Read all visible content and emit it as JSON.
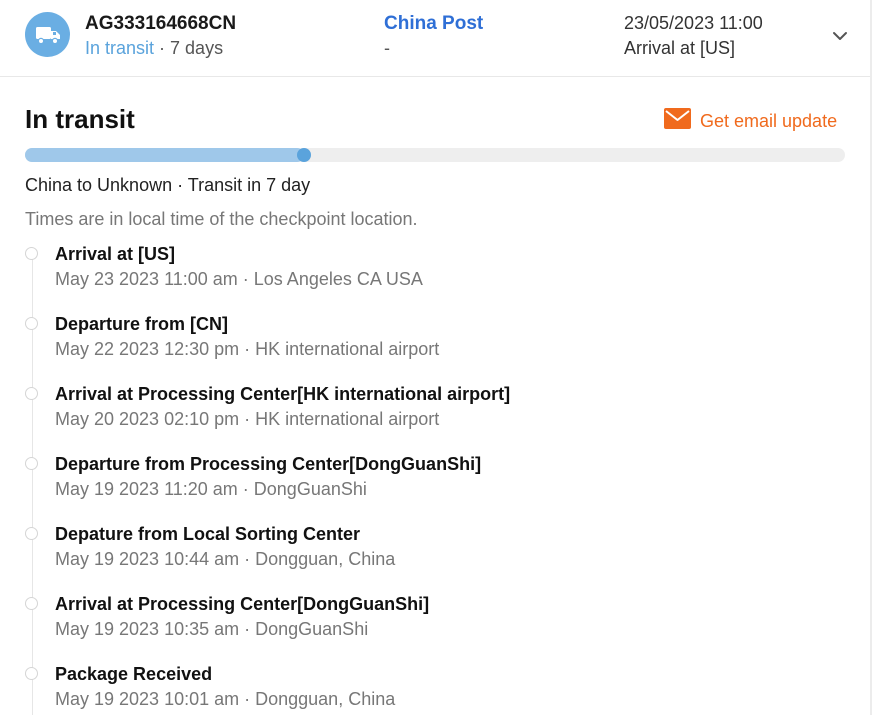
{
  "shipment": {
    "tracking_number": "AG333164668CN",
    "status": "In transit",
    "separator": " · ",
    "duration": "7 days",
    "carrier": "China Post",
    "carrier_sub": "-",
    "latest_time": "23/05/2023 11:00",
    "latest_event": "Arrival at [US]",
    "icon": "truck-icon",
    "expand_icon": "chevron-down-icon"
  },
  "detail": {
    "title": "In transit",
    "email_update_label": "Get email update",
    "email_icon": "envelope-icon",
    "progress_fraction": 0.34,
    "route": "China to Unknown · Transit in 7 day",
    "timezone_note": "Times are in local time of the checkpoint location."
  },
  "checkpoints": [
    {
      "event": "Arrival at [US]",
      "meta": "May 23 2023 11:00 am · Los Angeles CA USA"
    },
    {
      "event": "Departure from [CN]",
      "meta": "May 22 2023 12:30 pm · HK international airport"
    },
    {
      "event": "Arrival at Processing Center[HK international airport]",
      "meta": "May 20 2023 02:10 pm · HK international airport"
    },
    {
      "event": "Departure from Processing Center[DongGuanShi]",
      "meta": "May 19 2023 11:20 am · DongGuanShi"
    },
    {
      "event": "Depature from Local Sorting Center",
      "meta": "May 19 2023 10:44 am · Dongguan, China"
    },
    {
      "event": "Arrival at Processing Center[DongGuanShi]",
      "meta": "May 19 2023 10:35 am · DongGuanShi"
    },
    {
      "event": "Package Received",
      "meta": "May 19 2023 10:01 am · Dongguan, China"
    }
  ],
  "colors": {
    "accent_blue": "#5aa3dc",
    "carrier_blue": "#2f6fd6",
    "email_orange": "#f06a1d",
    "progress_fill": "#9fc8ea"
  }
}
